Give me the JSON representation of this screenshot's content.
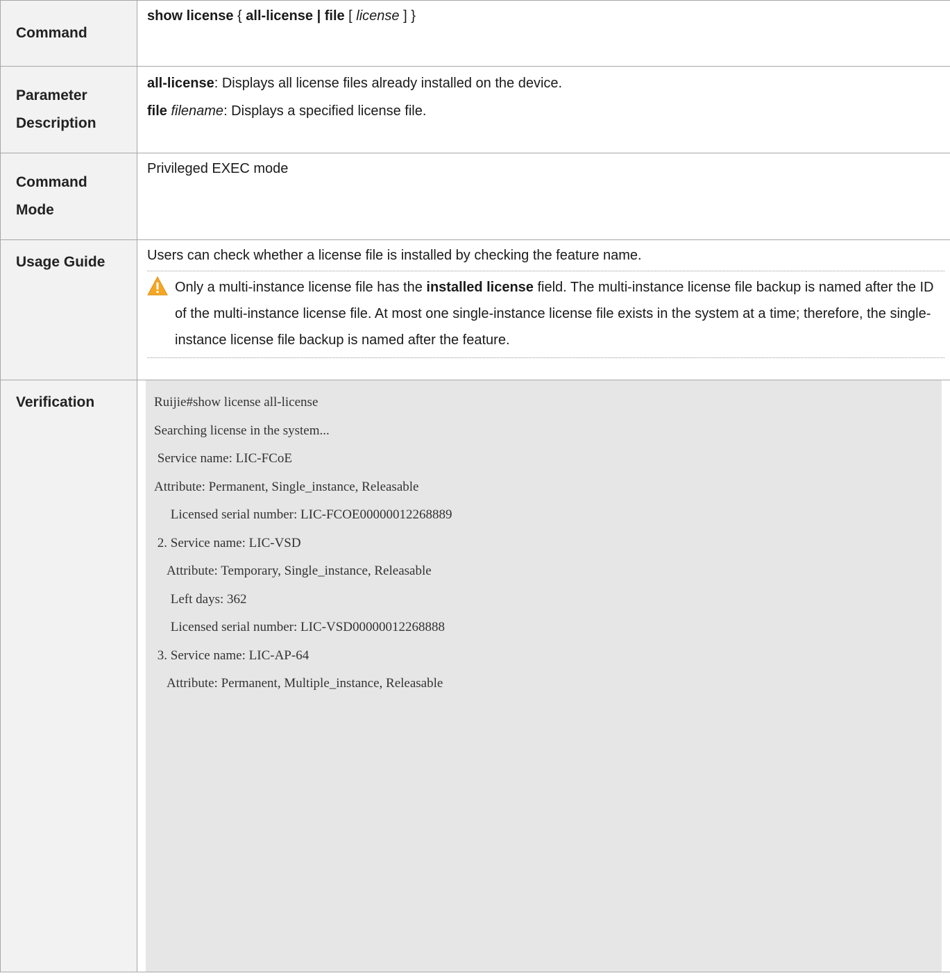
{
  "rows": {
    "command": {
      "label_lines": [
        "Command"
      ],
      "syntax": {
        "keyword": "show license",
        "brace_open": " { ",
        "opt1": "all-license | file",
        "bracket_open": " [ ",
        "arg": "license",
        "bracket_close": " ] }"
      }
    },
    "parameter": {
      "label_lines": [
        "Parameter",
        "Description"
      ],
      "items": [
        {
          "keyword": "all-license",
          "italic": "",
          "desc": ": Displays all license files already installed on the device."
        },
        {
          "keyword": "file",
          "italic": " filename",
          "desc": ": Displays a specified license file."
        }
      ]
    },
    "mode": {
      "label_lines": [
        "Command",
        "Mode"
      ],
      "text": "Privileged EXEC mode"
    },
    "usage": {
      "label_lines": [
        "Usage Guide"
      ],
      "text": "Users can check whether a license file is installed by checking the feature name.",
      "note": {
        "icon": "warning-icon",
        "before": "Only a multi-instance license file has the ",
        "bold": "installed license",
        "after": " field. The multi-instance license file backup is named after the ID of the multi-instance license file. At most one single-instance license file exists in the system at a time; therefore, the single-instance license file backup is named after the feature."
      }
    },
    "verification": {
      "label_lines": [
        "Verification"
      ],
      "code_lines": [
        "Ruijie#show license all-license",
        "Searching license in the system...",
        " Service name: LIC-FCoE",
        "Attribute: Permanent, Single_instance, Releasable",
        "     Licensed serial number: LIC-FCOE00000012268889",
        " 2. Service name: LIC-VSD",
        "    Attribute: Temporary, Single_instance, Releasable",
        "     Left days: 362",
        "     Licensed serial number: LIC-VSD00000012268888",
        " 3. Service name: LIC-AP-64",
        "    Attribute: Permanent, Multiple_instance, Releasable"
      ]
    }
  },
  "colors": {
    "label_bg": "#f2f2f2",
    "code_bg": "#e6e6e6",
    "border": "#a6a6a6",
    "warning": "#f5a623"
  }
}
